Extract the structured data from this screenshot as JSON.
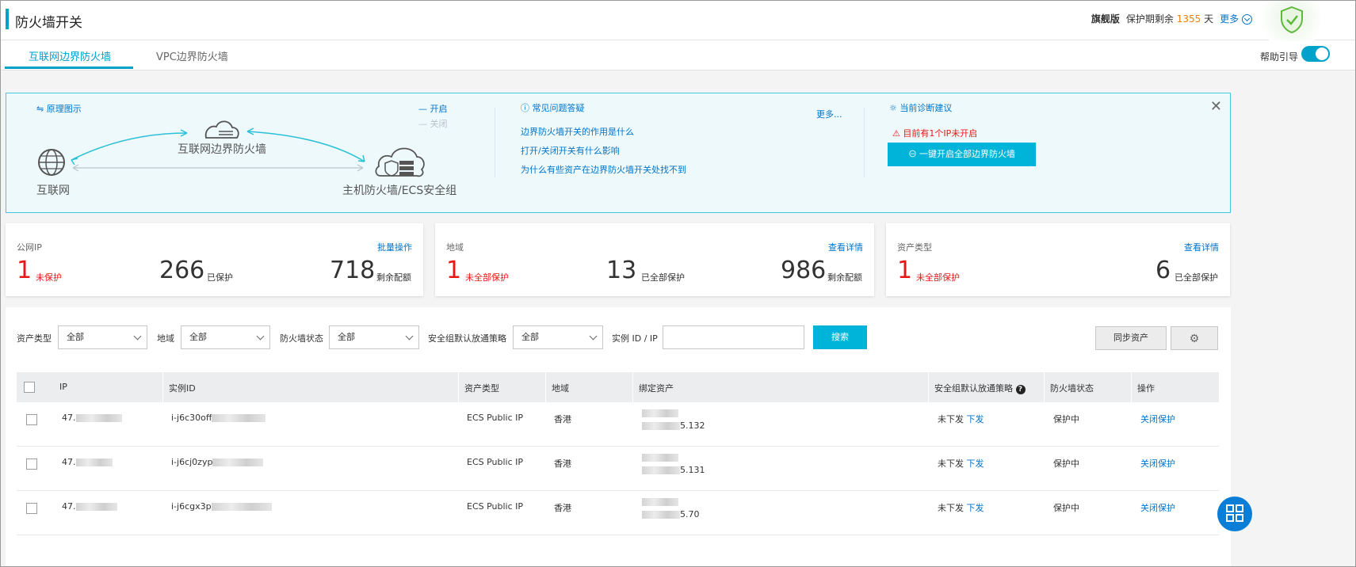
{
  "header": {
    "title": "防火墙开关",
    "edition": "旗舰版",
    "protect_prefix": "保护期剩余",
    "protect_days": "1355",
    "protect_suffix": "天",
    "more": "更多"
  },
  "tabs": [
    {
      "label": "互联网边界防火墙",
      "active": true
    },
    {
      "label": "VPC边界防火墙",
      "active": false
    }
  ],
  "help_guide": {
    "label": "帮助引导",
    "enabled": true
  },
  "banner": {
    "diagram_title": "原理图示",
    "legend_on": "— 开启",
    "legend_off": "— 关闭",
    "node_internet": "互联网",
    "node_border_fw": "互联网边界防火墙",
    "node_host_fw": "主机防火墙/ECS安全组",
    "faq_title": "常见问题答疑",
    "faq_more": "更多...",
    "faq_items": [
      "边界防火墙开关的作用是什么",
      "打开/关闭开关有什么影响",
      "为什么有些资产在边界防火墙开关处找不到"
    ],
    "diag_title": "当前诊断建议",
    "diag_warning": "目前有1个IP未开启",
    "diag_button": "一键开启全部边界防火墙"
  },
  "cards": [
    {
      "title": "公网IP",
      "link": "批量操作",
      "stat1_value": "1",
      "stat1_label": "未保护",
      "stat2_value": "266",
      "stat2_label": "已保护",
      "stat3_value": "718",
      "stat3_label": "剩余配额"
    },
    {
      "title": "地域",
      "link": "查看详情",
      "stat1_value": "1",
      "stat1_label": "未全部保护",
      "stat2_value": "13",
      "stat2_label": "已全部保护",
      "stat3_value": "986",
      "stat3_label": "剩余配额"
    },
    {
      "title": "资产类型",
      "link": "查看详情",
      "stat1_value": "1",
      "stat1_label": "未全部保护",
      "stat2_value": "6",
      "stat2_label": "已全部保护"
    }
  ],
  "filters": {
    "asset_type_label": "资产类型",
    "asset_type_value": "全部",
    "region_label": "地域",
    "region_value": "全部",
    "fw_status_label": "防火墙状态",
    "fw_status_value": "全部",
    "sg_policy_label": "安全组默认放通策略",
    "sg_policy_value": "全部",
    "instance_label": "实例 ID / IP",
    "instance_value": "",
    "search_button": "搜索",
    "sync_button": "同步资产"
  },
  "table": {
    "columns": [
      "IP",
      "实例ID",
      "资产类型",
      "地域",
      "绑定资产",
      "安全组默认放通策略",
      "防火墙状态",
      "操作"
    ],
    "rows": [
      {
        "ip": "47.",
        "instance": "i-j6c30off",
        "type": "ECS Public IP",
        "region": "香港",
        "bound_suffix": "5.132",
        "policy": "未下发",
        "policy_action": "下发",
        "status": "保护中",
        "op": "关闭保护"
      },
      {
        "ip": "47.",
        "instance": "i-j6cj0zyp",
        "type": "ECS Public IP",
        "region": "香港",
        "bound_suffix": "5.131",
        "policy": "未下发",
        "policy_action": "下发",
        "status": "保护中",
        "op": "关闭保护"
      },
      {
        "ip": "47.",
        "instance": "i-j6cgx3p",
        "type": "ECS Public IP",
        "region": "香港",
        "bound_suffix": "5.70",
        "policy": "未下发",
        "policy_action": "下发",
        "status": "保护中",
        "op": "关闭保护"
      }
    ]
  }
}
